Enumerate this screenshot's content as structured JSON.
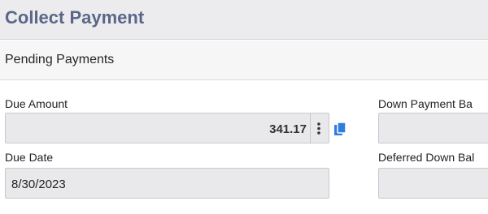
{
  "header": {
    "title": "Collect Payment"
  },
  "section": {
    "title": "Pending Payments"
  },
  "fields": {
    "due_amount": {
      "label": "Due Amount",
      "value": "341.17"
    },
    "due_date": {
      "label": "Due Date",
      "value": "8/30/2023"
    },
    "down_payment_balance": {
      "label": "Down Payment Ba",
      "value": ""
    },
    "deferred_down_balance": {
      "label": "Deferred Down Bal",
      "value": ""
    }
  },
  "icons": {
    "menu": "kebab-menu-icon",
    "copy": "copy-icon"
  },
  "colors": {
    "title": "#5a6788",
    "copy_icon": "#2f7de1"
  }
}
